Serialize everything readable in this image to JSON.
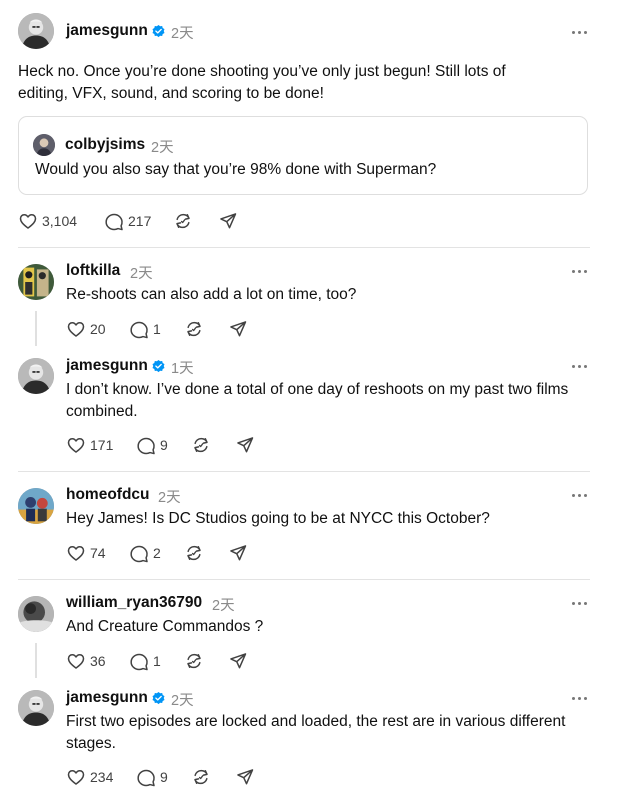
{
  "post": {
    "username": "jamesgunn",
    "time": "2天",
    "text": "Heck no. Once you’re done shooting you’ve only just begun! Still lots of editing, VFX, sound, and scoring to be done!",
    "quote": {
      "username": "colbyjsims",
      "time": "2天",
      "text": "Would you also say that you’re 98% done with Superman?"
    },
    "likes": "3,104",
    "replies": "217"
  },
  "comments": [
    {
      "username": "loftkilla",
      "time": "2天",
      "text": "Re-shoots can also add a lot on time, too?",
      "likes": "20",
      "replies": "1"
    },
    {
      "username": "jamesgunn",
      "time": "1天",
      "text": "I don’t know. I’ve done a total of one day of reshoots on my past two films combined.",
      "likes": "171",
      "replies": "9"
    },
    {
      "username": "homeofdcu",
      "time": "2天",
      "text": "Hey James! Is DC Studios going to be at NYCC this October?",
      "likes": "74",
      "replies": "2"
    },
    {
      "username": "william_ryan36790",
      "time": "2天",
      "text": "And Creature Commandos ?",
      "likes": "36",
      "replies": "1"
    },
    {
      "username": "jamesgunn",
      "time": "2天",
      "text": "First two episodes are locked and loaded, the rest are in various different stages.",
      "likes": "234",
      "replies": "9"
    }
  ],
  "colors": {
    "verified": "#0095f6",
    "text": "#101010",
    "muted": "#8a8a8a",
    "divider": "#e3e3e3"
  },
  "icons": [
    "heart-icon",
    "comment-icon",
    "repost-icon",
    "share-icon",
    "verified-badge-icon",
    "more-icon"
  ]
}
